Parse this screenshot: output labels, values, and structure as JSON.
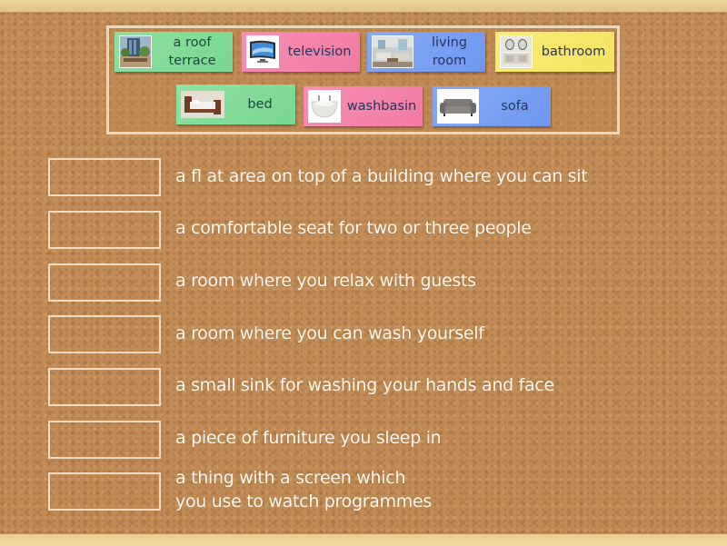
{
  "activity": {
    "type": "match-up",
    "answers": [
      {
        "label": "a roof\nterrace",
        "color": "#85dc9a",
        "image": "roof-terrace-photo"
      },
      {
        "label": "television",
        "color": "#f485ab",
        "image": "television-photo"
      },
      {
        "label": "living\nroom",
        "color": "#7ba0f3",
        "image": "living-room-photo"
      },
      {
        "label": "bathroom",
        "color": "#f6e86b",
        "image": "bathroom-photo"
      },
      {
        "label": "bed",
        "color": "#85dc9a",
        "image": "bed-photo"
      },
      {
        "label": "washbasin",
        "color": "#f485ab",
        "image": "washbasin-photo"
      },
      {
        "label": "sofa",
        "color": "#7ba0f3",
        "image": "sofa-photo"
      }
    ],
    "clues": [
      "a ﬂ at area on top of a building where you can sit",
      "a comfortable seat for two or three people",
      "a room where you relax with guests",
      "a room where you can wash yourself",
      "a small sink for washing your hands and face",
      "a piece of furniture you sleep in",
      "a thing with a screen which\nyou use to watch programmes"
    ]
  }
}
